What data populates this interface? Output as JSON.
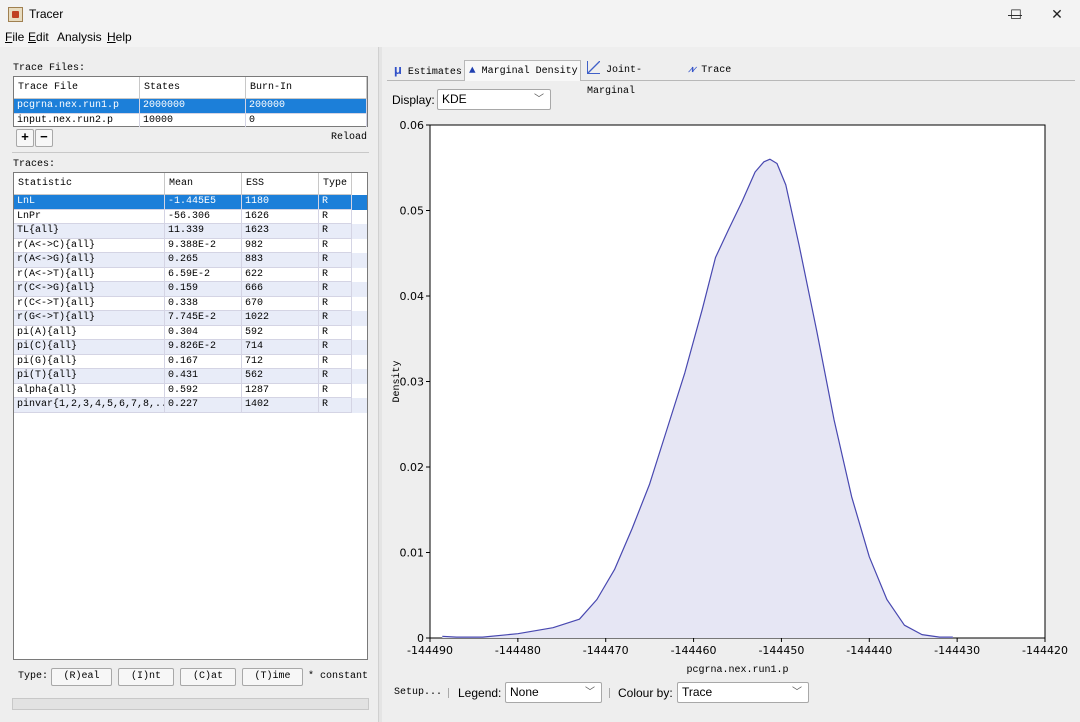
{
  "window": {
    "title": "Tracer",
    "minimize": "—",
    "maximize": "☐",
    "close": "✕"
  },
  "menu": [
    {
      "label": "File",
      "u": "F",
      "rest": "ile"
    },
    {
      "label": "Edit",
      "u": "E",
      "rest": "dit"
    },
    {
      "label": "Analysis",
      "u": "",
      "rest": "Analysis"
    },
    {
      "label": "Help",
      "u": "H",
      "rest": "elp"
    }
  ],
  "trace_files": {
    "label": "Trace Files:",
    "columns": [
      "Trace File",
      "States",
      "Burn-In"
    ],
    "rows": [
      [
        "pcgrna.nex.run1.p",
        "2000000",
        "200000"
      ],
      [
        "input.nex.run2.p",
        "10000",
        "0"
      ]
    ],
    "add": "+",
    "remove": "−",
    "reload": "Reload"
  },
  "traces": {
    "label": "Traces:",
    "columns": [
      "Statistic",
      "Mean",
      "ESS",
      "Type"
    ],
    "rows": [
      [
        "LnL",
        "-1.445E5",
        "1180",
        "R"
      ],
      [
        "LnPr",
        "-56.306",
        "1626",
        "R"
      ],
      [
        "TL{all}",
        "11.339",
        "1623",
        "R"
      ],
      [
        "r(A<->C){all}",
        "9.388E-2",
        "982",
        "R"
      ],
      [
        "r(A<->G){all}",
        "0.265",
        "883",
        "R"
      ],
      [
        "r(A<->T){all}",
        "6.59E-2",
        "622",
        "R"
      ],
      [
        "r(C<->G){all}",
        "0.159",
        "666",
        "R"
      ],
      [
        "r(C<->T){all}",
        "0.338",
        "670",
        "R"
      ],
      [
        "r(G<->T){all}",
        "7.745E-2",
        "1022",
        "R"
      ],
      [
        "pi(A){all}",
        "0.304",
        "592",
        "R"
      ],
      [
        "pi(C){all}",
        "9.826E-2",
        "714",
        "R"
      ],
      [
        "pi(G){all}",
        "0.167",
        "712",
        "R"
      ],
      [
        "pi(T){all}",
        "0.431",
        "562",
        "R"
      ],
      [
        "alpha{all}",
        "0.592",
        "1287",
        "R"
      ],
      [
        "pinvar{1,2,3,4,5,6,7,8,...",
        "0.227",
        "1402",
        "R"
      ]
    ]
  },
  "type_bar": {
    "label": "Type:",
    "buttons": [
      "(R)eal",
      "(I)nt",
      "(C)at",
      "(T)ime"
    ],
    "note": "* constant"
  },
  "tabs": [
    {
      "label": "Estimates",
      "icon": "mu-icon"
    },
    {
      "label": "Marginal Density",
      "icon": "density-icon"
    },
    {
      "label": "Joint-Marginal",
      "icon": "joint-icon"
    },
    {
      "label": "Trace",
      "icon": "trace-icon"
    }
  ],
  "display": {
    "label": "Display:",
    "value": "KDE"
  },
  "bottom_bar": {
    "setup": "Setup...",
    "legend_label": "Legend:",
    "legend_value": "None",
    "colour_label": "Colour by:",
    "colour_value": "Trace"
  },
  "colors": {
    "selection": "#1c7fd9",
    "curve": "#4848b0",
    "fill": "#e6e6f4"
  },
  "chart_data": {
    "type": "area",
    "xlabel": "pcgrna.nex.run1.p",
    "ylabel": "Density",
    "xlim": [
      -144490,
      -144420
    ],
    "ylim": [
      0,
      0.06
    ],
    "xticks": [
      -144490,
      -144480,
      -144470,
      -144460,
      -144450,
      -144440,
      -144430,
      -144420
    ],
    "yticks": [
      0,
      0.01,
      0.02,
      0.03,
      0.04,
      0.05,
      0.06
    ],
    "xtick_labels": [
      "-144490",
      "-144480",
      "-144470",
      "-144460",
      "-144450",
      "-144440",
      "-144430",
      "-144420"
    ],
    "ytick_labels": [
      "0",
      "0.01",
      "0.02",
      "0.03",
      "0.04",
      "0.05",
      "0.06"
    ],
    "x": [
      -144488.6,
      -144487,
      -144484,
      -144480,
      -144476,
      -144473,
      -144471,
      -144469,
      -144467,
      -144465,
      -144463,
      -144461,
      -144459,
      -144457.5,
      -144456,
      -144454.5,
      -144453,
      -144452,
      -144451.3,
      -144450.5,
      -144449.5,
      -144448,
      -144446,
      -144444,
      -144442,
      -144440,
      -144438,
      -144436,
      -144434,
      -144432,
      -144430.5
    ],
    "y": [
      0.0002,
      0.0001,
      0.0001,
      0.0005,
      0.0012,
      0.0022,
      0.0045,
      0.008,
      0.0128,
      0.018,
      0.0245,
      0.031,
      0.0385,
      0.0445,
      0.0478,
      0.051,
      0.0545,
      0.0557,
      0.056,
      0.0555,
      0.053,
      0.046,
      0.036,
      0.0255,
      0.0165,
      0.0095,
      0.0045,
      0.0015,
      0.0004,
      0.0001,
      0.0001
    ]
  }
}
